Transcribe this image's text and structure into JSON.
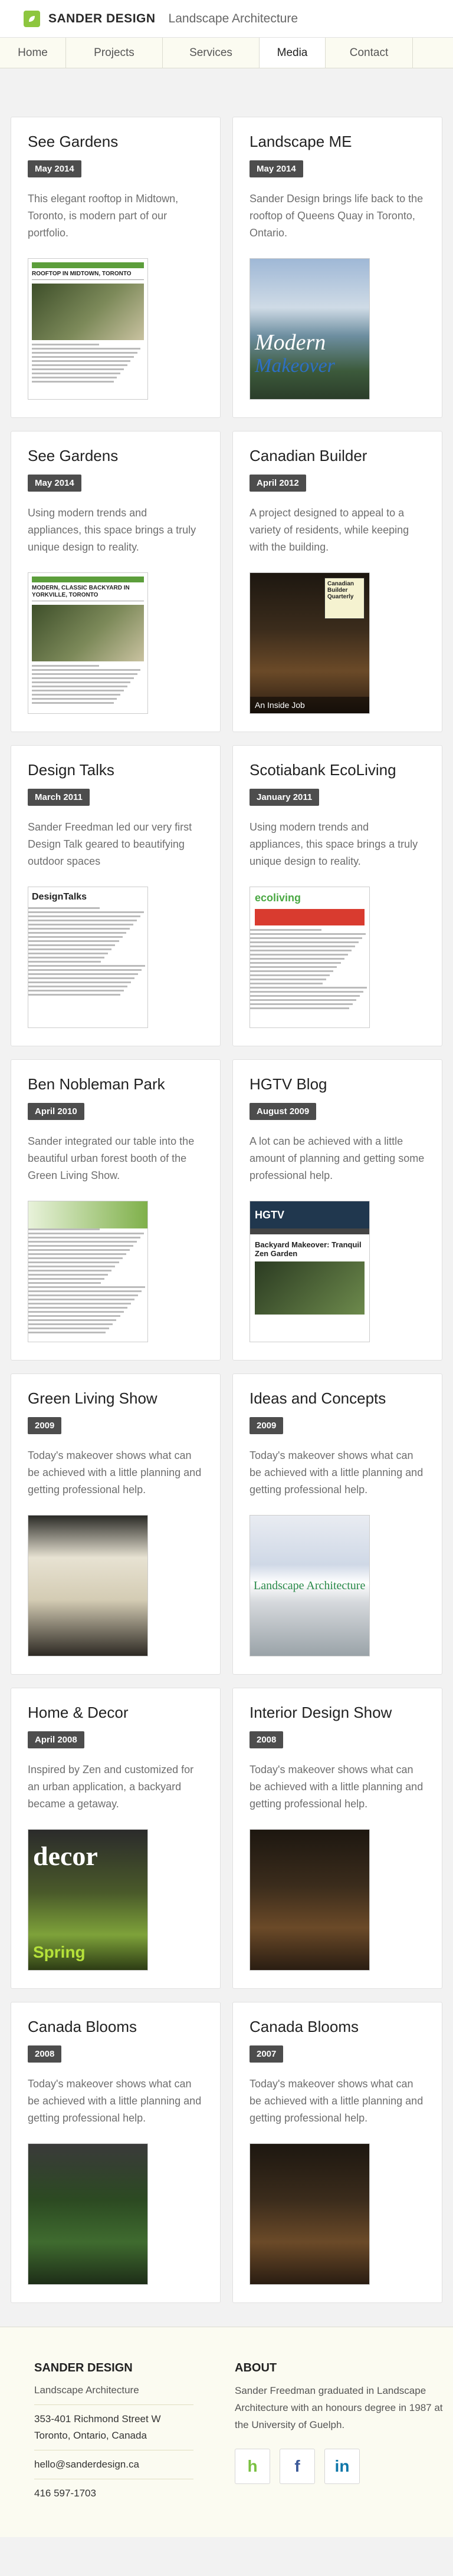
{
  "header": {
    "brand": "SANDER DESIGN",
    "tagline": "Landscape Architecture",
    "accent_color": "#8dc63f"
  },
  "nav": [
    {
      "label": "Home"
    },
    {
      "label": "Projects"
    },
    {
      "label": "Services"
    },
    {
      "label": "Media",
      "active": true
    },
    {
      "label": "Contact"
    }
  ],
  "cards": [
    {
      "title": "See Gardens",
      "date": "May 2014",
      "text": "This elegant rooftop in Midtown, Toronto, is modern part of our portfolio.",
      "thumb": {
        "kind": "magazine",
        "caption": "ROOFTOP IN MIDTOWN, TORONTO"
      }
    },
    {
      "title": "Landscape ME",
      "date": "May 2014",
      "text": "Sander Design brings life back to the rooftop of Queens Quay in Toronto, Ontario.",
      "thumb": {
        "kind": "city",
        "line1": "Modern",
        "line2": "Makeover"
      }
    },
    {
      "title": "See Gardens",
      "date": "May 2014",
      "text": "Using modern trends and appliances, this space brings a truly unique design to reality.",
      "thumb": {
        "kind": "magazine",
        "caption": "MODERN, CLASSIC BACKYARD IN YORKVILLE, TORONTO"
      }
    },
    {
      "title": "Canadian Builder",
      "date": "April 2012",
      "text": "A project designed to appeal to a variety of residents, while keeping with the building.",
      "thumb": {
        "kind": "builder",
        "logo": "Canadian Builder Quarterly",
        "strip": "An Inside Job"
      }
    },
    {
      "title": "Design Talks",
      "date": "March 2011",
      "text": "Sander Freedman led our very first Design Talk geared to beautifying outdoor spaces",
      "thumb": {
        "kind": "designtalks",
        "logo": "DesignTalks"
      }
    },
    {
      "title": "Scotiabank EcoLiving",
      "date": "January 2011",
      "text": "Using modern trends and appliances, this space brings a truly unique design to reality.",
      "thumb": {
        "kind": "ecoliving",
        "logo": "ecoliving"
      }
    },
    {
      "title": "Ben Nobleman Park",
      "date": "April 2010",
      "text": "Sander integrated our table into the beautiful urban forest booth of the Green Living Show.",
      "thumb": {
        "kind": "article"
      }
    },
    {
      "title": "HGTV Blog",
      "date": "August 2009",
      "text": "A lot can be achieved with a little amount of planning and getting some professional help.",
      "thumb": {
        "kind": "blog",
        "logo": "HGTV",
        "caption": "Backyard Makeover: Tranquil Zen Garden"
      }
    },
    {
      "title": "Green Living Show",
      "date": "2009",
      "text": "Today's makeover shows what can be achieved with a little planning and getting professional help.",
      "thumb": {
        "kind": "photo-cream"
      }
    },
    {
      "title": "Ideas and Concepts",
      "date": "2009",
      "text": "Today's makeover shows what can be achieved with a little planning and getting professional help.",
      "thumb": {
        "kind": "lsa",
        "logo": "Landscape Architecture"
      }
    },
    {
      "title": "Home & Decor",
      "date": "April 2008",
      "text": "Inspired by Zen and customized for an urban application, a backyard became a getaway.",
      "thumb": {
        "kind": "decor",
        "logo": "decor",
        "cover": "Spring"
      }
    },
    {
      "title": "Interior Design Show",
      "date": "2008",
      "text": "Today's makeover shows what can be achieved with a little planning and getting professional help.",
      "thumb": {
        "kind": "photo-dark"
      }
    },
    {
      "title": "Canada Blooms",
      "date": "2008",
      "text": "Today's makeover shows what can be achieved with a little planning and getting professional help.",
      "thumb": {
        "kind": "photo-green"
      }
    },
    {
      "title": "Canada Blooms",
      "date": "2007",
      "text": "Today's makeover shows what can be achieved with a little planning and getting professional help.",
      "thumb": {
        "kind": "photo-dark"
      }
    }
  ],
  "footer": {
    "company": "SANDER DESIGN",
    "tagline": "Landscape Architecture",
    "address1": "353-401 Richmond Street W",
    "address2": "Toronto, Ontario, Canada",
    "email": "hello@sanderdesign.ca",
    "phone": "416 597-1703",
    "about_heading": "ABOUT",
    "about_text": "Sander Freedman graduated in Landscape Architecture with an honours degree in 1987 at the University of Guelph.",
    "social": [
      {
        "icon": "houzz-icon",
        "glyph": "h",
        "color": "#7ac142"
      },
      {
        "icon": "facebook-icon",
        "glyph": "f",
        "color": "#3b5998"
      },
      {
        "icon": "linkedin-icon",
        "glyph": "in",
        "color": "#0e76a8"
      }
    ]
  }
}
